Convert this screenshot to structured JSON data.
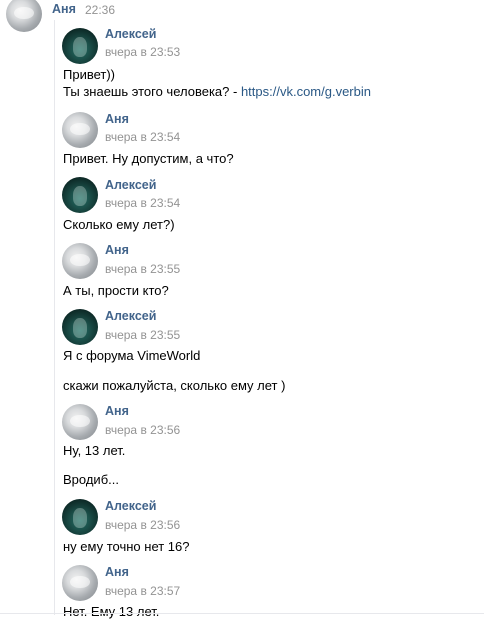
{
  "header": {
    "author": "Аня",
    "time": "22:36"
  },
  "messages": [
    {
      "author": "Алексей",
      "date": "вчера в 23:53",
      "lines": [
        "Привет))"
      ],
      "text_prefix": "Ты знаешь этого человека? - ",
      "link": "https://vk.com/g.verbin"
    },
    {
      "author": "Аня",
      "date": "вчера в 23:54",
      "lines": [
        "Привет. Ну допустим, а что?"
      ]
    },
    {
      "author": "Алексей",
      "date": "вчера в 23:54",
      "lines": [
        "Сколько ему лет?)"
      ]
    },
    {
      "author": "Аня",
      "date": "вчера в 23:55",
      "lines": [
        "А ты, прости кто?"
      ]
    },
    {
      "author": "Алексей",
      "date": "вчера в 23:55",
      "lines": [
        "Я с форума VimeWorld",
        "скажи пожалуйста, сколько ему лет )"
      ]
    },
    {
      "author": "Аня",
      "date": "вчера в 23:56",
      "lines": [
        "Ну, 13 лет.",
        "Вродиб..."
      ]
    },
    {
      "author": "Алексей",
      "date": "вчера в 23:56",
      "lines": [
        "ну ему точно нет 16?"
      ]
    },
    {
      "author": "Аня",
      "date": "вчера в 23:57",
      "lines": [
        "Нет. Ему 13 лет."
      ]
    }
  ]
}
